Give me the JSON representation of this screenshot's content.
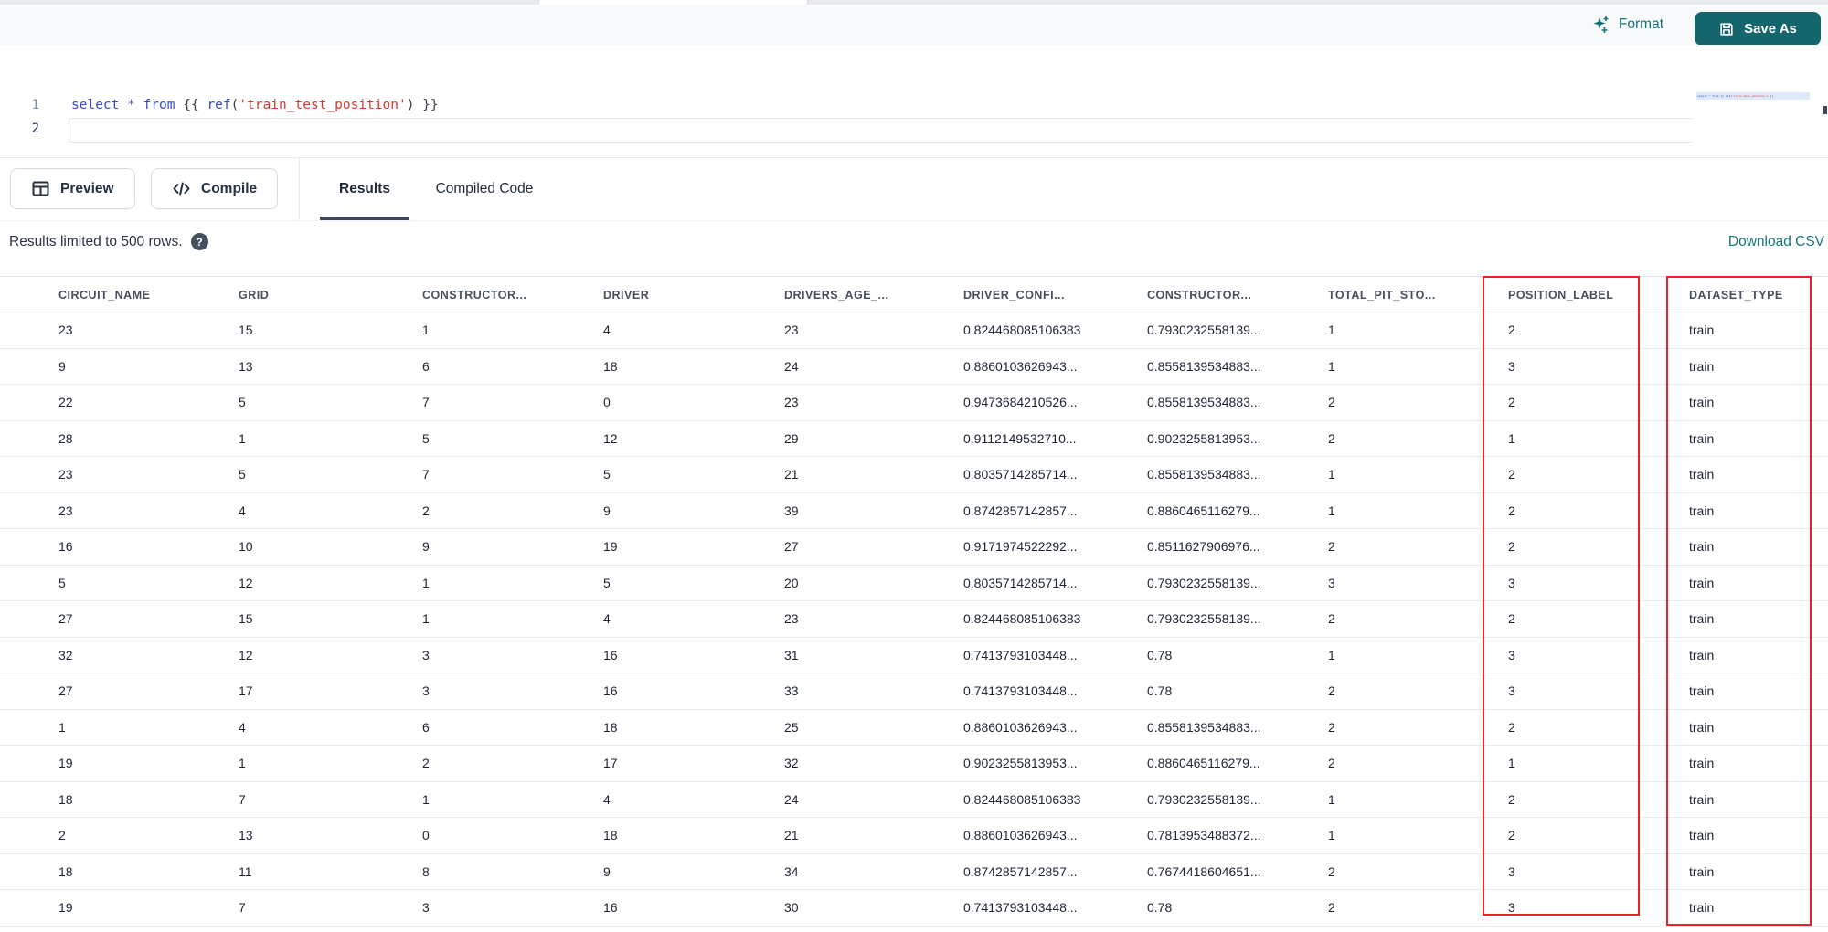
{
  "toolbar": {
    "format_label": "Format",
    "save_as_label": "Save As"
  },
  "editor": {
    "line_numbers": [
      "1",
      "2"
    ],
    "code_tokens": [
      {
        "t": "select",
        "c": "kw"
      },
      {
        "t": " ",
        "c": "pl"
      },
      {
        "t": "*",
        "c": "op"
      },
      {
        "t": " ",
        "c": "pl"
      },
      {
        "t": "from",
        "c": "kw"
      },
      {
        "t": " ",
        "c": "pl"
      },
      {
        "t": "{{ ",
        "c": "pn"
      },
      {
        "t": "ref",
        "c": "fn"
      },
      {
        "t": "(",
        "c": "pn"
      },
      {
        "t": "'train_test_position'",
        "c": "str"
      },
      {
        "t": ")",
        "c": "pn"
      },
      {
        "t": " }}",
        "c": "pn"
      }
    ],
    "code_plain": "select * from {{ ref('train_test_position') }}"
  },
  "results_panel": {
    "preview_label": "Preview",
    "compile_label": "Compile",
    "tabs": [
      {
        "label": "Results",
        "active": true
      },
      {
        "label": "Compiled Code",
        "active": false
      }
    ],
    "limit_note": "Results limited to 500 rows.",
    "help_glyph": "?",
    "download_label": "Download CSV"
  },
  "table": {
    "columns": [
      "CIRCUIT_NAME",
      "GRID",
      "CONSTRUCTOR...",
      "DRIVER",
      "DRIVERS_AGE_...",
      "DRIVER_CONFI...",
      "CONSTRUCTOR...",
      "TOTAL_PIT_STO...",
      "POSITION_LABEL",
      "DATASET_TYPE"
    ],
    "highlighted_columns": [
      "POSITION_LABEL",
      "DATASET_TYPE"
    ],
    "rows": [
      [
        "23",
        "15",
        "1",
        "4",
        "23",
        "0.824468085106383",
        "0.7930232558139...",
        "1",
        "2",
        "train"
      ],
      [
        "9",
        "13",
        "6",
        "18",
        "24",
        "0.8860103626943...",
        "0.8558139534883...",
        "1",
        "3",
        "train"
      ],
      [
        "22",
        "5",
        "7",
        "0",
        "23",
        "0.9473684210526...",
        "0.8558139534883...",
        "2",
        "2",
        "train"
      ],
      [
        "28",
        "1",
        "5",
        "12",
        "29",
        "0.9112149532710...",
        "0.9023255813953...",
        "2",
        "1",
        "train"
      ],
      [
        "23",
        "5",
        "7",
        "5",
        "21",
        "0.8035714285714...",
        "0.8558139534883...",
        "1",
        "2",
        "train"
      ],
      [
        "23",
        "4",
        "2",
        "9",
        "39",
        "0.8742857142857...",
        "0.8860465116279...",
        "1",
        "2",
        "train"
      ],
      [
        "16",
        "10",
        "9",
        "19",
        "27",
        "0.9171974522292...",
        "0.8511627906976...",
        "2",
        "2",
        "train"
      ],
      [
        "5",
        "12",
        "1",
        "5",
        "20",
        "0.8035714285714...",
        "0.7930232558139...",
        "3",
        "3",
        "train"
      ],
      [
        "27",
        "15",
        "1",
        "4",
        "23",
        "0.824468085106383",
        "0.7930232558139...",
        "2",
        "2",
        "train"
      ],
      [
        "32",
        "12",
        "3",
        "16",
        "31",
        "0.7413793103448...",
        "0.78",
        "1",
        "3",
        "train"
      ],
      [
        "27",
        "17",
        "3",
        "16",
        "33",
        "0.7413793103448...",
        "0.78",
        "2",
        "3",
        "train"
      ],
      [
        "1",
        "4",
        "6",
        "18",
        "25",
        "0.8860103626943...",
        "0.8558139534883...",
        "2",
        "2",
        "train"
      ],
      [
        "19",
        "1",
        "2",
        "17",
        "32",
        "0.9023255813953...",
        "0.8860465116279...",
        "2",
        "1",
        "train"
      ],
      [
        "18",
        "7",
        "1",
        "4",
        "24",
        "0.824468085106383",
        "0.7930232558139...",
        "1",
        "2",
        "train"
      ],
      [
        "2",
        "13",
        "0",
        "18",
        "21",
        "0.8860103626943...",
        "0.7813953488372...",
        "1",
        "2",
        "train"
      ],
      [
        "18",
        "11",
        "8",
        "9",
        "34",
        "0.8742857142857...",
        "0.7674418604651...",
        "2",
        "3",
        "train"
      ],
      [
        "19",
        "7",
        "3",
        "16",
        "30",
        "0.7413793103448...",
        "0.78",
        "2",
        "3",
        "train"
      ]
    ]
  },
  "colors": {
    "accent_teal": "#14666c",
    "link_teal": "#16777d",
    "highlight_red": "#ec2227",
    "header_text": "#46505e",
    "cell_text": "#1c2433"
  }
}
